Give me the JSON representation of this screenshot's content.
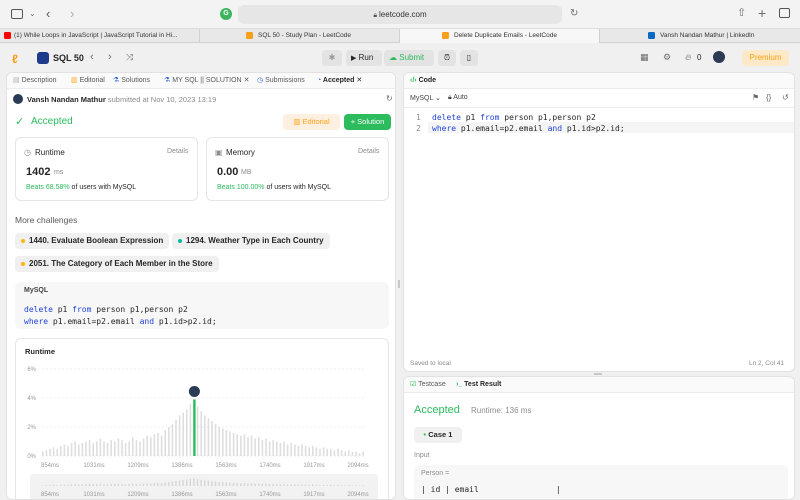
{
  "browser": {
    "url": "leetcode.com",
    "tabs": [
      {
        "title": "(1) While Loops in JavaScript | JavaScript Tutorial in Hi...",
        "fav_color": "#ff0000"
      },
      {
        "title": "SQL 50 - Study Plan - LeetCode",
        "fav_color": "#f89f1b"
      },
      {
        "title": "Delete Duplicate Emails - LeetCode",
        "fav_color": "#f89f1b"
      },
      {
        "title": "Vansh Nandan Mathur | LinkedIn",
        "fav_color": "#0a66c2"
      }
    ]
  },
  "header": {
    "plan_name": "SQL 50",
    "run_label": "Run",
    "submit_label": "Submit",
    "streak_count": "0",
    "premium_label": "Premium"
  },
  "left": {
    "tabs": [
      "Description",
      "Editorial",
      "Solutions",
      "MY SQL || SOLUTION",
      "Submissions",
      "Accepted"
    ],
    "submitter": "Vansh Nandan Mathur",
    "submitted_text": "submitted at Nov 10, 2023 13:19",
    "status": "Accepted",
    "editorial_btn": "Editorial",
    "solution_btn": "Solution",
    "runtime": {
      "label": "Runtime",
      "details": "Details",
      "value": "1402",
      "unit": "ms",
      "beats": "Beats 68.58%",
      "beats_rest": "of users with MySQL"
    },
    "memory": {
      "label": "Memory",
      "details": "Details",
      "value": "0.00",
      "unit": "MB",
      "beats": "Beats 100.00%",
      "beats_rest": "of users with MySQL"
    },
    "more_title": "More challenges",
    "challenges": [
      {
        "label": "1440. Evaluate Boolean Expression",
        "dot": "#ffb800"
      },
      {
        "label": "1294. Weather Type in Each Country",
        "dot": "#00b8a3"
      },
      {
        "label": "2051. The Category of Each Member in the Store",
        "dot": "#ffb800"
      }
    ],
    "code_lang": "MySQL",
    "code_line1": [
      "delete",
      " p1 ",
      "from",
      " person p1,person p2"
    ],
    "code_line2": [
      "where",
      " p1.email=p2.email ",
      "and",
      " p1.id>p2.id;"
    ],
    "chart_title": "Runtime"
  },
  "chart_data": {
    "type": "bar",
    "title": "Runtime",
    "ylabel_ticks": [
      "6%",
      "4%",
      "2%",
      "0%"
    ],
    "xtick_labels": [
      "854ms",
      "1031ms",
      "1209ms",
      "1386ms",
      "1563ms",
      "1740ms",
      "1917ms",
      "2094ms"
    ],
    "ylim": [
      0,
      6
    ],
    "highlight_index": 42,
    "values": [
      0.3,
      0.4,
      0.5,
      0.6,
      0.5,
      0.7,
      0.8,
      0.7,
      0.9,
      1.0,
      0.8,
      0.9,
      1.0,
      1.1,
      0.9,
      1.0,
      1.2,
      1.0,
      0.9,
      1.1,
      1.0,
      1.2,
      1.1,
      0.9,
      1.0,
      1.3,
      1.1,
      1.0,
      1.2,
      1.4,
      1.3,
      1.5,
      1.6,
      1.4,
      1.8,
      2.0,
      2.2,
      2.5,
      2.8,
      3.0,
      3.2,
      3.6,
      3.9,
      3.4,
      3.1,
      2.8,
      2.6,
      2.4,
      2.2,
      2.0,
      1.9,
      1.8,
      1.7,
      1.6,
      1.5,
      1.4,
      1.5,
      1.3,
      1.4,
      1.2,
      1.3,
      1.1,
      1.2,
      1.0,
      1.1,
      1.0,
      0.9,
      1.0,
      0.8,
      0.9,
      0.8,
      0.7,
      0.8,
      0.7,
      0.6,
      0.7,
      0.6,
      0.5,
      0.6,
      0.5,
      0.5,
      0.4,
      0.5,
      0.4,
      0.3,
      0.4,
      0.3,
      0.3,
      0.2,
      0.3
    ]
  },
  "editor": {
    "title": "Code",
    "lang": "MySQL",
    "auto": "Auto",
    "line1_num": "1",
    "line2_num": "2",
    "saved": "Saved to local",
    "cursor": "Ln 2, Col 41"
  },
  "result": {
    "testcase_tab": "Testcase",
    "result_tab": "Test Result",
    "status": "Accepted",
    "runtime_text": "Runtime: 136 ms",
    "case_label": "Case 1",
    "input_label": "Input",
    "person_label": "Person =",
    "table_header": "| id | email                |"
  },
  "colors": {
    "accent_green": "#2cbb5d",
    "keyword_blue": "#2142d6",
    "premium": "#ffa116"
  }
}
